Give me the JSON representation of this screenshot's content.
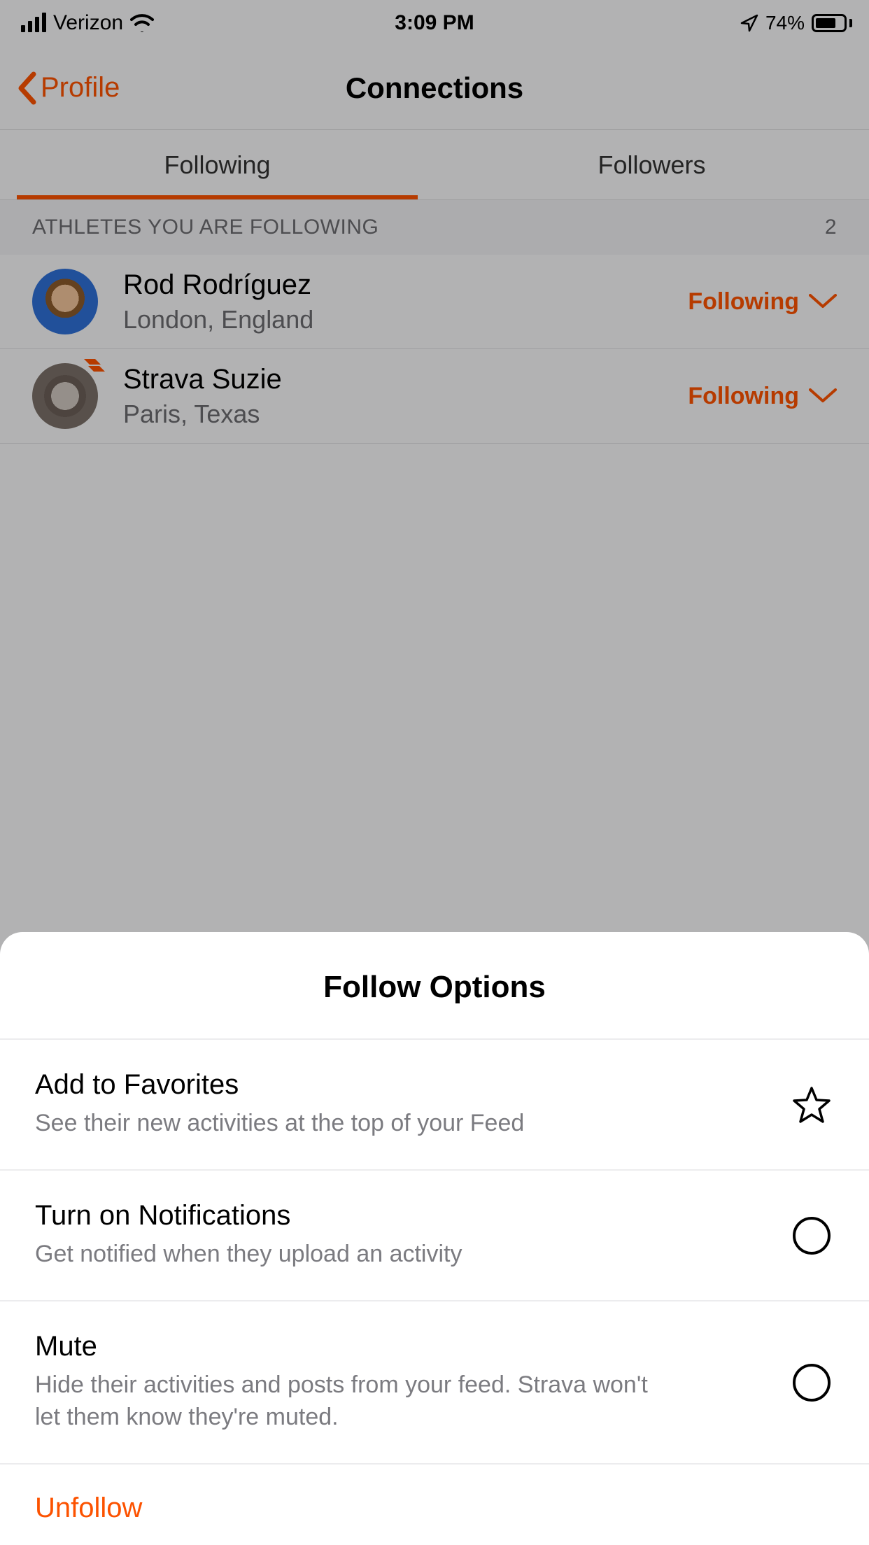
{
  "status": {
    "carrier": "Verizon",
    "time": "3:09 PM",
    "battery_pct": "74%"
  },
  "nav": {
    "back_label": "Profile",
    "title": "Connections"
  },
  "tabs": {
    "following": "Following",
    "followers": "Followers"
  },
  "section": {
    "title": "ATHLETES YOU ARE FOLLOWING",
    "count": "2"
  },
  "athletes": [
    {
      "name": "Rod Rodríguez",
      "location": "London, England",
      "status": "Following"
    },
    {
      "name": "Strava Suzie",
      "location": "Paris, Texas",
      "status": "Following"
    }
  ],
  "sheet": {
    "title": "Follow Options",
    "options": [
      {
        "title": "Add to Favorites",
        "sub": "See their new activities at the top of your Feed"
      },
      {
        "title": "Turn on Notifications",
        "sub": "Get notified when they upload an activity"
      },
      {
        "title": "Mute",
        "sub": "Hide their activities and posts from your feed. Strava won't let them know they're muted."
      }
    ],
    "unfollow": "Unfollow"
  },
  "colors": {
    "accent": "#fc5200"
  }
}
